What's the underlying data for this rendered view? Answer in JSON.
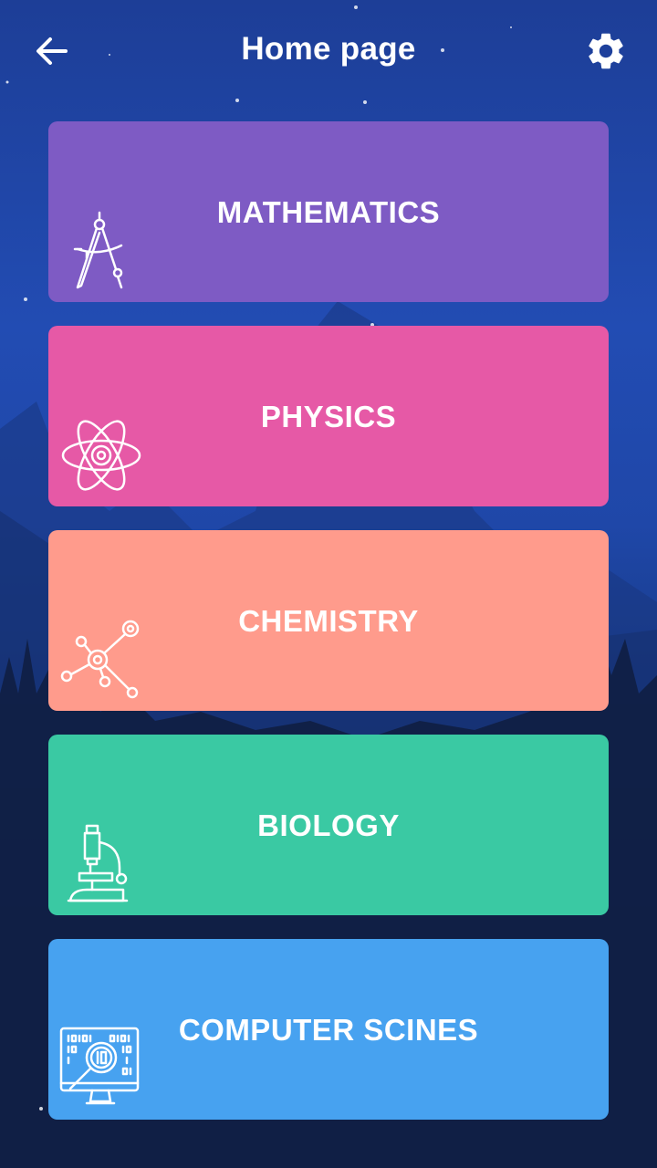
{
  "header": {
    "title": "Home page",
    "back_icon": "arrow-left-icon",
    "settings_icon": "gear-icon"
  },
  "subjects": [
    {
      "label": "MATHEMATICS",
      "icon": "compass-icon",
      "color": "#7e5bc4"
    },
    {
      "label": "PHYSICS",
      "icon": "atom-icon",
      "color": "#e659a6"
    },
    {
      "label": "CHEMISTRY",
      "icon": "molecule-icon",
      "color": "#ff9b8c"
    },
    {
      "label": "BIOLOGY",
      "icon": "microscope-icon",
      "color": "#3ac9a3"
    },
    {
      "label": "COMPUTER SCINES",
      "icon": "computer-search-icon",
      "color": "#47a2f0"
    }
  ],
  "colors": {
    "background_top": "#1d3e97",
    "background_bottom": "#0a1329",
    "text": "#ffffff"
  }
}
